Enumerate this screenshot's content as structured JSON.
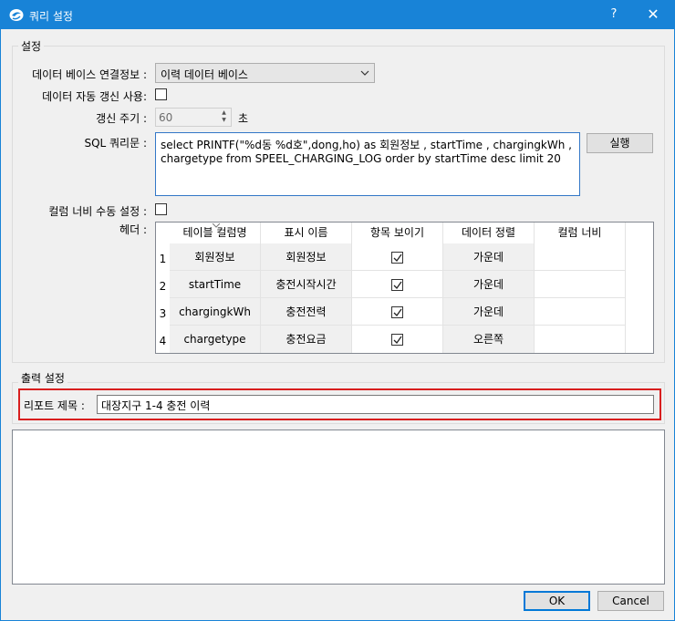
{
  "window": {
    "title": "쿼리 설정",
    "help": "?",
    "close": "✕"
  },
  "settings": {
    "group_label": "설정",
    "db_label": "데이터 베이스 연결정보 :",
    "db_value": "이력 데이터 베이스",
    "auto_refresh_label": "데이터 자동 갱신 사용:",
    "auto_refresh_checked": false,
    "refresh_period_label": "갱신 주기 :",
    "refresh_period_value": "60",
    "refresh_period_unit": "초",
    "sql_label": "SQL 쿼리문 :",
    "sql_text": "select PRINTF(\"%d동 %d호\",dong,ho) as 회원정보 , startTime , chargingkWh   , chargetype from SPEEL_CHARGING_LOG order by startTime desc limit 20",
    "run_button": "실행",
    "manual_width_label": "컬럼 너비 수동 설정 :",
    "manual_width_checked": false,
    "header_label": "헤더 :"
  },
  "grid": {
    "columns": [
      "테이블 컬럼명",
      "표시 이름",
      "항목 보이기",
      "데이터 정렬",
      "컬럼 너비"
    ],
    "rows": [
      {
        "num": "1",
        "column": "회원정보",
        "display": "회원정보",
        "visible": true,
        "align": "가운데",
        "width": ""
      },
      {
        "num": "2",
        "column": "startTime",
        "display": "충전시작시간",
        "visible": true,
        "align": "가운데",
        "width": ""
      },
      {
        "num": "3",
        "column": "chargingkWh",
        "display": "충전전력",
        "visible": true,
        "align": "가운데",
        "width": ""
      },
      {
        "num": "4",
        "column": "chargetype",
        "display": "충전요금",
        "visible": true,
        "align": "오른쪽",
        "width": ""
      }
    ]
  },
  "output": {
    "group_label": "출력 설정",
    "report_title_label": "리포트 제목 :",
    "report_title_value": "대장지구 1-4 충전 이력"
  },
  "footer": {
    "ok": "OK",
    "cancel": "Cancel"
  },
  "colors": {
    "titlebar": "#1883d7",
    "highlight_border": "#d81e1e",
    "focus_border": "#0078d7"
  }
}
